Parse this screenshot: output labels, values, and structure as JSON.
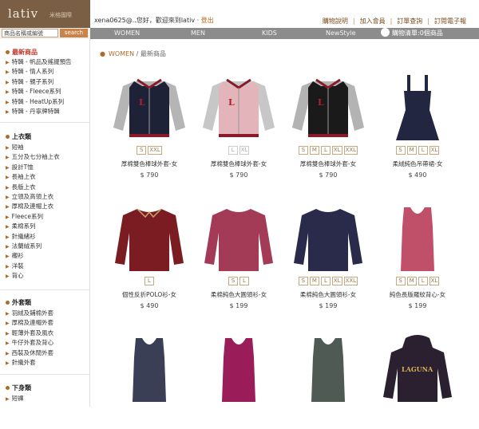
{
  "header": {
    "brand": "lativ",
    "brand_sub": "米格國際",
    "greeting_user": "xena0625@",
    "greeting_rest": "..您好，歡迎來到lativ",
    "logout": "登出",
    "links": [
      "購物說明",
      "加入會員",
      "訂單查詢",
      "訂閱電子報"
    ]
  },
  "search": {
    "value": "商品名稱或編號",
    "button": "search"
  },
  "nav": {
    "tabs": [
      "WOMEN",
      "MEN",
      "KIDS",
      "NewStyle"
    ],
    "cart": "購物清單:0個商品"
  },
  "sidebar": {
    "new_title": "最新商品",
    "new_items": [
      "特輯 - 帆品及搖擺預告",
      "特輯 - 情人系列",
      "特輯 - 親子系列",
      "特輯 - Fleece系列",
      "特輯 - HeatUp系列",
      "特輯 - 丹寧牌特輯"
    ],
    "tops_title": "上衣類",
    "tops_items": [
      "短袖",
      "五分及七分袖上衣",
      "設計T恤",
      "長袖上衣",
      "長版上衣",
      "立領及高領上衣",
      "厚棉及連帽上衣",
      "Fleece系列",
      "柔棉系列",
      "針織緒衫",
      "法蘭絨系列",
      "襯衫",
      "洋裝",
      "背心"
    ],
    "outer_title": "外套類",
    "outer_items": [
      "羽絨及鋪棉外套",
      "厚棉及連帽外套",
      "輕薄外套及風衣",
      "牛仔外套及背心",
      "西裝及休閒外套",
      "針織外套"
    ],
    "bottoms_title": "下身類",
    "bottoms_items": [
      "短褲"
    ]
  },
  "breadcrumb": {
    "section": "WOMEN",
    "page": "最新商品"
  },
  "products": [
    {
      "name": "厚棉雙色棒球外套-女",
      "price": "$ 790",
      "sizes": [
        "S",
        "XXL"
      ],
      "color": "#1e2236",
      "sleeve": "#b5b5b5",
      "kind": "jacket"
    },
    {
      "name": "厚棉雙色棒球外套-女",
      "price": "$ 790",
      "sizes": [
        "L",
        "XL"
      ],
      "color": "#e3b5ba",
      "sleeve": "#c7c7c7",
      "kind": "jacket"
    },
    {
      "name": "厚棉雙色棒球外套-女",
      "price": "$ 790",
      "sizes": [
        "S",
        "M",
        "L",
        "XL",
        "XXL"
      ],
      "color": "#1a1a1a",
      "sleeve": "#b3b3b3",
      "kind": "jacket"
    },
    {
      "name": "柔絨純色吊帶裙-女",
      "price": "$ 490",
      "sizes": [
        "S",
        "M",
        "L",
        "XL"
      ],
      "color": "#232640",
      "sleeve": "",
      "kind": "dress"
    },
    {
      "name": "個性反折POLO衫-女",
      "price": "$ 490",
      "sizes": [
        "L"
      ],
      "color": "#7a1c22",
      "sleeve": "#7a1c22",
      "kind": "polo"
    },
    {
      "name": "柔棉純色大圓領衫-女",
      "price": "$ 199",
      "sizes": [
        "S",
        "L"
      ],
      "color": "#a33b57",
      "sleeve": "#a33b57",
      "kind": "tee"
    },
    {
      "name": "柔棉純色大圓領衫-女",
      "price": "$ 199",
      "sizes": [
        "S",
        "M",
        "L",
        "XL",
        "XXL"
      ],
      "color": "#2a2a4a",
      "sleeve": "#2a2a4a",
      "kind": "tee"
    },
    {
      "name": "純色長版羅紋背心-女",
      "price": "$ 199",
      "sizes": [
        "S",
        "M",
        "L",
        "XL"
      ],
      "color": "#c0506a",
      "sleeve": "",
      "kind": "tank"
    },
    {
      "name": "",
      "price": "",
      "sizes": [],
      "color": "#3b3f55",
      "sleeve": "",
      "kind": "tank"
    },
    {
      "name": "",
      "price": "",
      "sizes": [],
      "color": "#9a1d5a",
      "sleeve": "",
      "kind": "tank"
    },
    {
      "name": "",
      "price": "",
      "sizes": [],
      "color": "#4f5a55",
      "sleeve": "",
      "kind": "tank"
    },
    {
      "name": "",
      "price": "",
      "sizes": [],
      "color": "#2a2030",
      "sleeve": "#2a2030",
      "kind": "hoodie"
    }
  ],
  "colors": {
    "brand": "#7a5f45",
    "accent": "#b06a2c",
    "nav": "#8c8c8c"
  }
}
